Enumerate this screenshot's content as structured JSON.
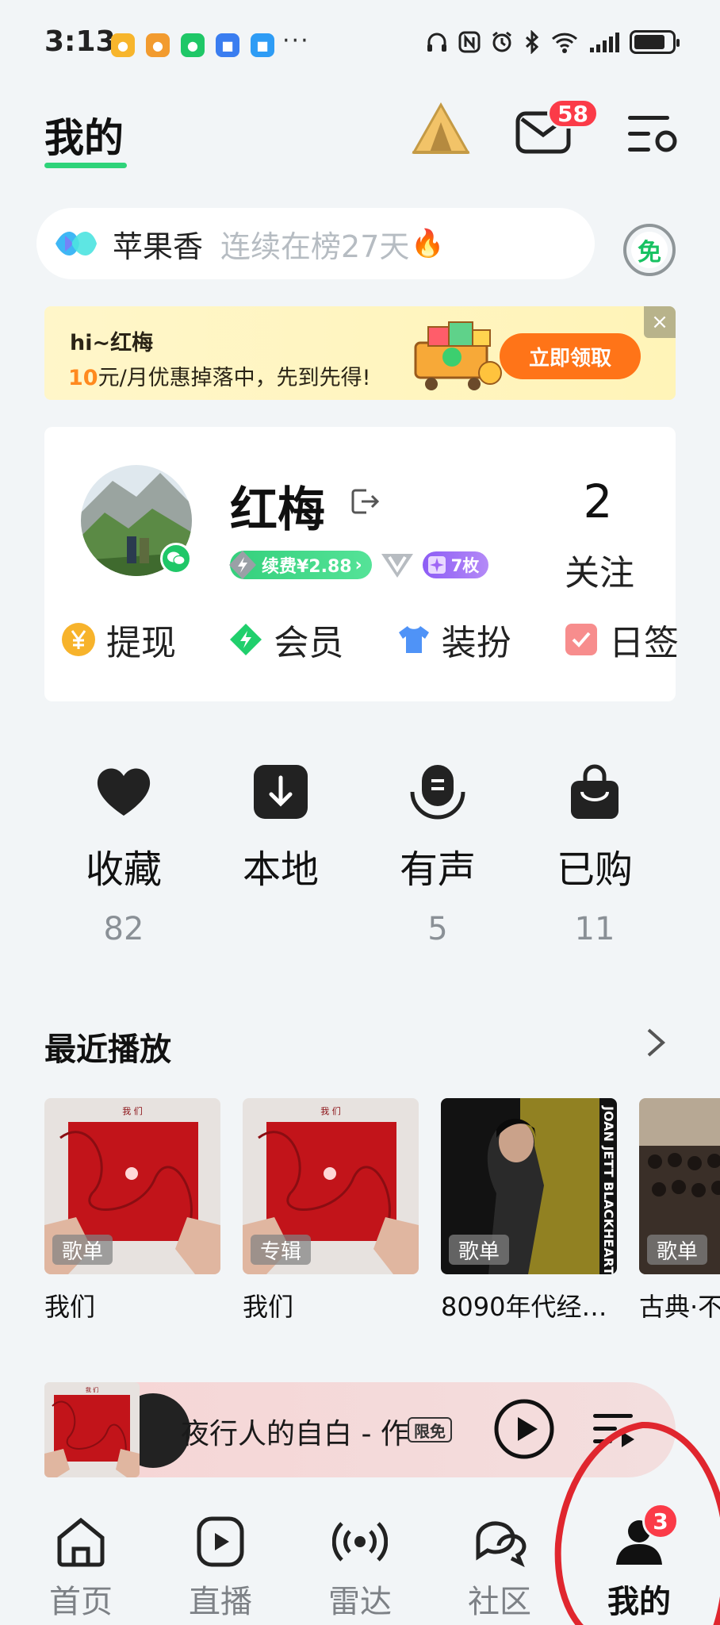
{
  "status_bar": {
    "time": "3:13",
    "more": "···",
    "app_icons": [
      "weibo-icon",
      "weibo-icon",
      "wechat-icon",
      "app-icon",
      "chat-icon"
    ],
    "system_icons": [
      "headphones-icon",
      "nfc-icon",
      "alarm-icon",
      "bluetooth-icon",
      "wifi-icon",
      "signal-icon",
      "battery-icon"
    ]
  },
  "header": {
    "title": "我的",
    "mail_badge": "58",
    "accent": "#2fd37a"
  },
  "search": {
    "song": "苹果香",
    "rank_text": "连续在榜27天",
    "free_label": "免"
  },
  "promo": {
    "greeting": "hi~红梅",
    "price": "10",
    "offer_text": "元/月优惠掉落中，先到先得!",
    "button": "立即领取",
    "close": "×"
  },
  "profile": {
    "name": "红梅",
    "renew_label": "续费¥2.88",
    "coins_label": "7枚",
    "follow_count": "2",
    "follow_label": "关注",
    "quick_actions": [
      {
        "label": "提现",
        "icon": "yen-coin-icon"
      },
      {
        "label": "会员",
        "icon": "diamond-icon"
      },
      {
        "label": "装扮",
        "icon": "tshirt-icon"
      },
      {
        "label": "日签",
        "icon": "checkbox-icon"
      }
    ]
  },
  "shortcuts": [
    {
      "label": "收藏",
      "count": "82",
      "icon": "heart-icon"
    },
    {
      "label": "本地",
      "count": "",
      "icon": "download-icon"
    },
    {
      "label": "有声",
      "count": "5",
      "icon": "podcast-icon"
    },
    {
      "label": "已购",
      "count": "11",
      "icon": "bag-icon"
    }
  ],
  "recent": {
    "title": "最近播放",
    "items": [
      {
        "tag": "歌单",
        "name": "我们",
        "cover_text": "我 们"
      },
      {
        "tag": "专辑",
        "name": "我们",
        "cover_text": "我 们"
      },
      {
        "tag": "歌单",
        "name": "8090年代经…",
        "cover_text": "JOAN JETT BLACKHEARTS"
      },
      {
        "tag": "歌单",
        "name": "古典·不",
        "cover_text": ""
      }
    ]
  },
  "player": {
    "title": "夜行人的自白 - 作",
    "limited": "限免",
    "cover_text": "我 们"
  },
  "tabs": [
    {
      "label": "首页",
      "icon": "home-icon",
      "active": false
    },
    {
      "label": "直播",
      "icon": "live-play-icon",
      "active": false
    },
    {
      "label": "雷达",
      "icon": "radar-icon",
      "active": false
    },
    {
      "label": "社区",
      "icon": "chat-bubbles-icon",
      "active": false
    },
    {
      "label": "我的",
      "icon": "user-icon",
      "active": true,
      "badge": "3"
    }
  ]
}
